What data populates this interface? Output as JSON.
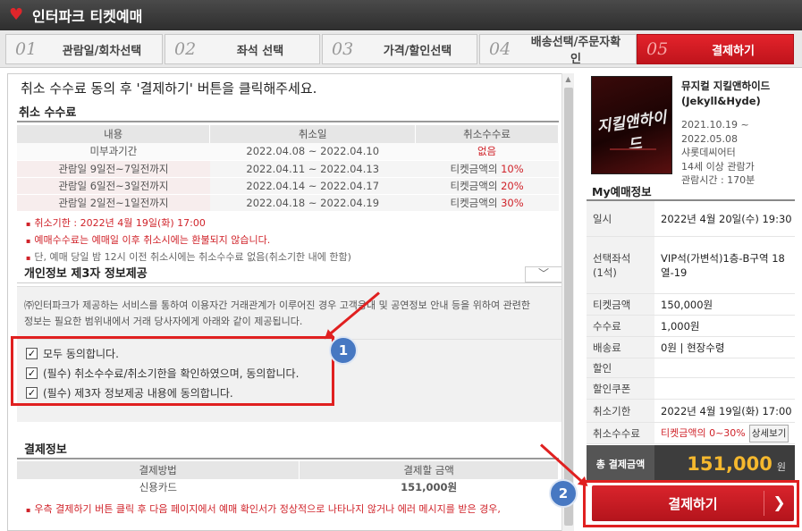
{
  "app": {
    "title": "인터파크 티켓예매"
  },
  "steps": [
    {
      "num": "01",
      "label": "관람일/회차선택"
    },
    {
      "num": "02",
      "label": "좌석 선택"
    },
    {
      "num": "03",
      "label": "가격/할인선택"
    },
    {
      "num": "04",
      "label": "배송선택/주문자확인"
    },
    {
      "num": "05",
      "label": "결제하기"
    }
  ],
  "instruction": "취소 수수료 동의 후 '결제하기' 버튼을 클릭해주세요.",
  "cancel_fee": {
    "title": "취소 수수료",
    "headers": [
      "내용",
      "취소일",
      "취소수수료"
    ],
    "rows": [
      {
        "c1": "미부과기간",
        "c2": "2022.04.08 ~ 2022.04.10",
        "fee_prefix": "",
        "fee": "없음"
      },
      {
        "c1": "관람일 9일전~7일전까지",
        "c2": "2022.04.11 ~ 2022.04.13",
        "fee_prefix": "티켓금액의 ",
        "fee": "10%"
      },
      {
        "c1": "관람일 6일전~3일전까지",
        "c2": "2022.04.14 ~ 2022.04.17",
        "fee_prefix": "티켓금액의 ",
        "fee": "20%"
      },
      {
        "c1": "관람일 2일전~1일전까지",
        "c2": "2022.04.18 ~ 2022.04.19",
        "fee_prefix": "티켓금액의 ",
        "fee": "30%"
      }
    ],
    "notes": [
      "취소기한 : 2022년 4월 19일(화) 17:00",
      "예매수수료는 예매일 이후 취소시에는 환불되지 않습니다.",
      "단, 예매 당일 밤 12시 이전 취소시에는 취소수수료 없음(취소기한 내에 한함)"
    ]
  },
  "privacy": {
    "title": "개인정보 제3자 정보제공",
    "dropdown_icon": "chevron-down-icon",
    "text": "㈜인터파크가 제공하는 서비스를 통하여 이용자간 거래관계가 이루어진 경우 고객응대 및 공연정보 안내 등을 위하여 관련한 정보는 필요한 범위내에서 거래 당사자에게 아래와 같이 제공됩니다.",
    "consents": [
      "모두 동의합니다.",
      "(필수) 취소수수료/취소기한을 확인하였으며, 동의합니다.",
      "(필수) 제3자 정보제공 내용에 동의합니다."
    ]
  },
  "payment_info": {
    "title": "결제정보",
    "headers": [
      "결제방법",
      "결제할 금액"
    ],
    "method": "신용카드",
    "amount": "151,000원",
    "note": "우측 결제하기 버튼 클릭 후 다음 페이지에서 예매 확인서가 정상적으로 나타나지 않거나 에러 메시지를 받은 경우,"
  },
  "show": {
    "title_line1": "뮤지컬 지킬앤하이드",
    "title_line2": "(Jekyll&Hyde)",
    "dates": "2021.10.19 ~",
    "dates2": "2022.05.08",
    "venue": "샤롯데씨어터",
    "age": "14세 이상 관람가",
    "runtime": "관람시간 : 170분",
    "poster_text": "지킬앤하이드"
  },
  "my_info": {
    "title": "My예매정보",
    "date_label": "일시",
    "date_value": "2022년 4월 20일(수) 19:30",
    "seat_label": "선택좌석",
    "seat_count": "(1석)",
    "seat_value": "VIP석(가변석)1층-B구역 18열-19",
    "ticket_label": "티켓금액",
    "ticket_value": "150,000원",
    "fee_label": "수수료",
    "fee_value": "1,000원",
    "delivery_label": "배송료",
    "delivery_value": "0원 | 현장수령",
    "discount_label": "할인",
    "coupon_label": "할인쿠폰",
    "deadline_label": "취소기한",
    "deadline_value": "2022년 4월 19일(화) 17:00",
    "cancel_fee_label": "취소수수료",
    "cancel_fee_value": "티켓금액의 0~30%",
    "detail_btn": "상세보기",
    "total_label": "총 결제금액",
    "total_value": "151,000",
    "total_unit": "원"
  },
  "pay_button": {
    "label": "결제하기",
    "icon": "chevron-right-icon"
  },
  "annotations": {
    "badge1": "1",
    "badge2": "2"
  },
  "colors": {
    "accent": "#d0232a",
    "badge": "#4778c2"
  }
}
